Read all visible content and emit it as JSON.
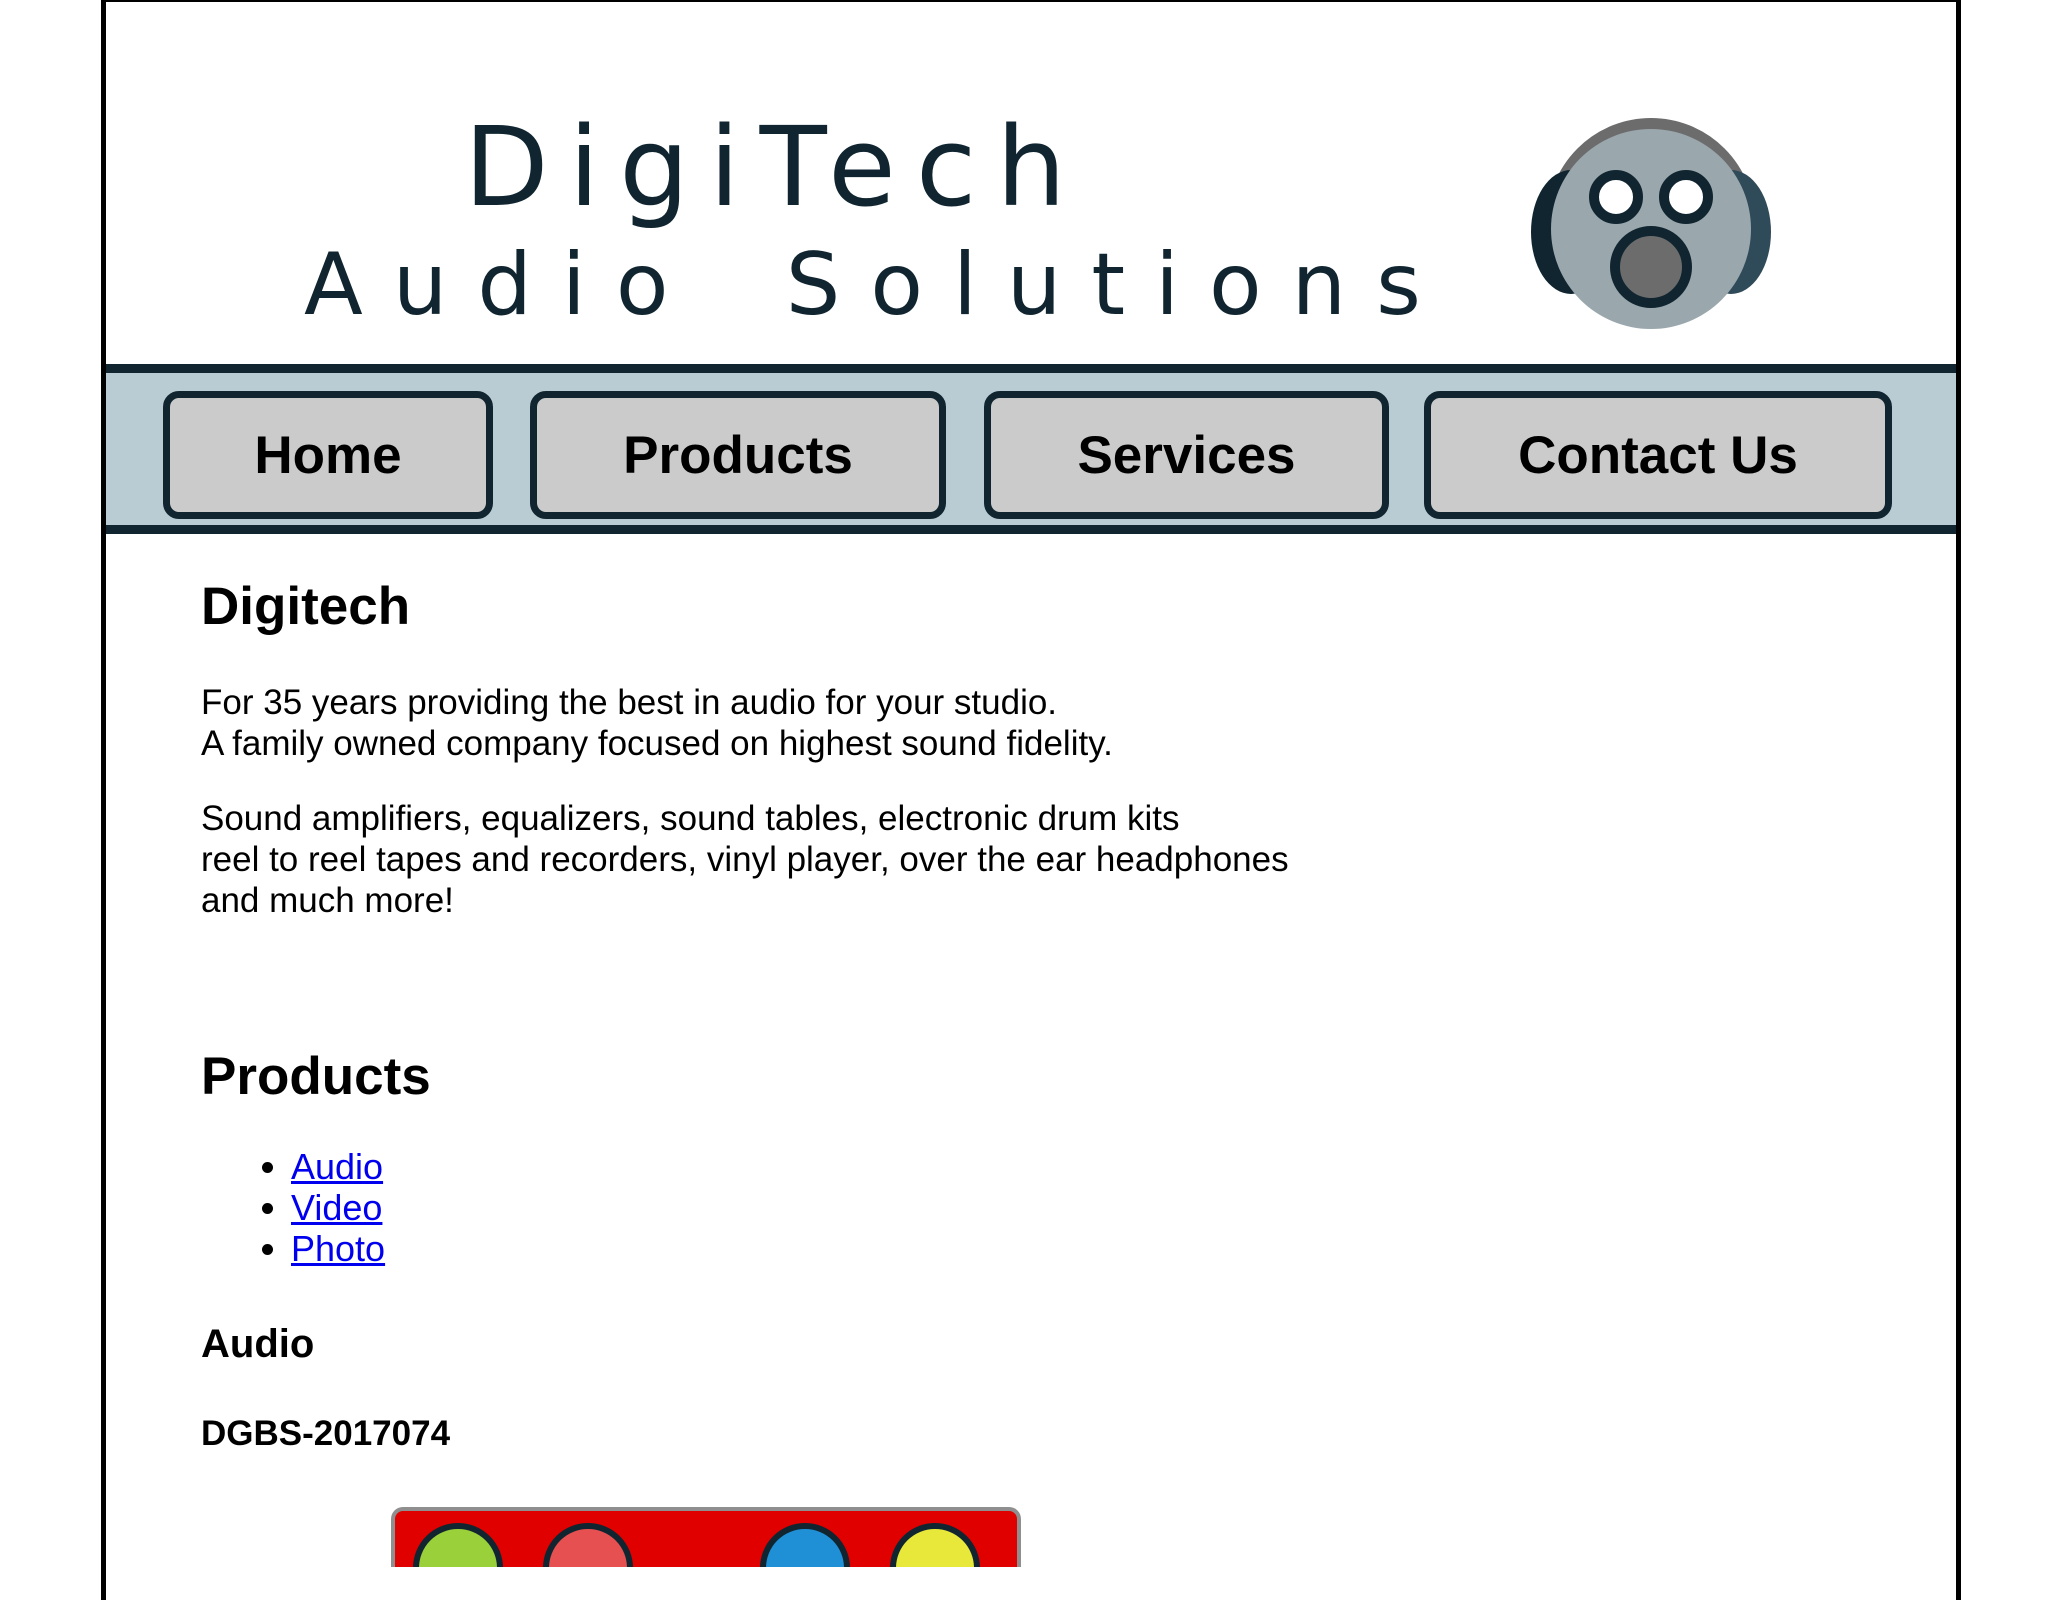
{
  "brand": {
    "line1": "DigiTech",
    "line2": "Audio Solutions",
    "logo_icon": "headphones-face-icon",
    "colors": {
      "dark": "#102530",
      "face": "#9aa7ad",
      "band": "#6c6c6c"
    }
  },
  "nav": {
    "items": [
      {
        "label": "Home"
      },
      {
        "label": "Products"
      },
      {
        "label": "Services"
      },
      {
        "label": "Contact Us"
      }
    ],
    "background": "#b9ccd4",
    "button_color": "#cbcbcb"
  },
  "intro": {
    "heading": "Digitech",
    "para1": [
      "For 35 years providing the best in audio for your studio.",
      "A family owned company focused on highest sound fidelity."
    ],
    "para2": [
      "Sound amplifiers, equalizers, sound tables, electronic drum kits",
      "reel to reel tapes and recorders, vinyl player, over the ear headphones",
      "and much more!"
    ]
  },
  "products": {
    "heading": "Products",
    "links": [
      "Audio",
      "Video",
      "Photo"
    ],
    "audio_heading": "Audio",
    "model": "DGBS-2017074",
    "device_knob_colors": [
      "#9ad03a",
      "#e65050",
      "#1f8fd6",
      "#e8e83a"
    ]
  }
}
